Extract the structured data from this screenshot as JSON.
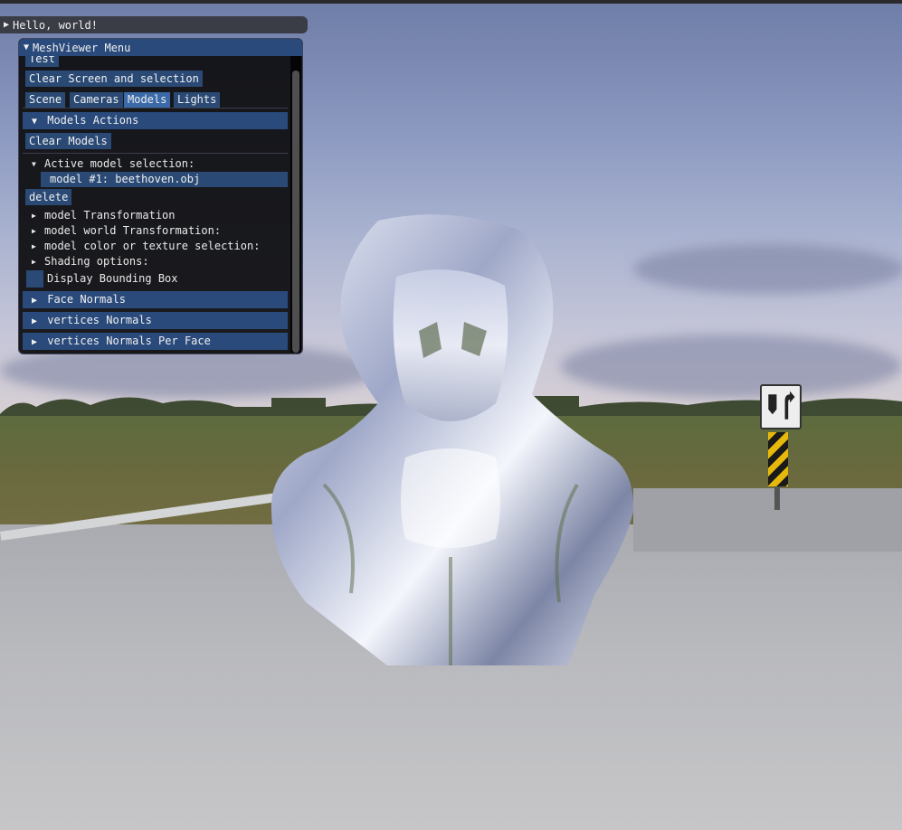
{
  "collapsed_window": {
    "title": "Hello, world!"
  },
  "menu_window": {
    "title": "MeshViewer Menu",
    "test_button": "Test",
    "clear_screen_button": "Clear Screen and selection",
    "tabs": [
      {
        "label": "Scene",
        "active": false
      },
      {
        "label": "Cameras",
        "active": false
      },
      {
        "label": "Models",
        "active": true
      },
      {
        "label": "Lights",
        "active": false
      }
    ],
    "models_actions_header": "Models Actions",
    "clear_models_button": "Clear Models",
    "active_model_selection_label": "Active model selection:",
    "selected_model": "model #1: beethoven.obj",
    "delete_button": "delete",
    "tree_items": [
      "model Transformation",
      "model world Transformation:",
      "model color or texture selection:",
      "Shading options:"
    ],
    "display_bounding_box_label": "Display Bounding Box",
    "display_bounding_box_checked": false,
    "collapsing_headers": [
      "Face Normals",
      "vertices Normals",
      "vertices Normals Per Face"
    ]
  },
  "colors": {
    "title_active": "#294a7a",
    "button": "#2a4a75",
    "window_bg": "#0f0f11"
  },
  "icons": [
    "triangle-right-icon",
    "triangle-down-icon"
  ]
}
